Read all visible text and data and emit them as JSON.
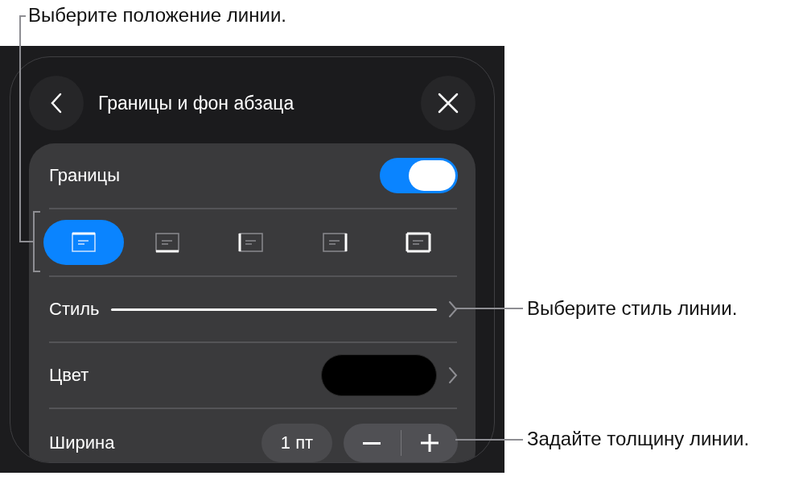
{
  "callouts": [
    {
      "text": "Выберите положение линии."
    },
    {
      "text": "Выберите стиль линии."
    },
    {
      "text": "Задайте толщину линии."
    }
  ],
  "panel": {
    "title": "Границы и фон абзаца",
    "borders_toggle": {
      "label": "Границы",
      "on": true
    },
    "positions": [
      {
        "kind": "top",
        "selected": true
      },
      {
        "kind": "bottom",
        "selected": false
      },
      {
        "kind": "left",
        "selected": false
      },
      {
        "kind": "right",
        "selected": false
      },
      {
        "kind": "all",
        "selected": false
      }
    ],
    "style_row": {
      "label": "Стиль"
    },
    "color_row": {
      "label": "Цвет"
    },
    "width_row": {
      "label": "Ширина",
      "value": "1 пт"
    }
  }
}
